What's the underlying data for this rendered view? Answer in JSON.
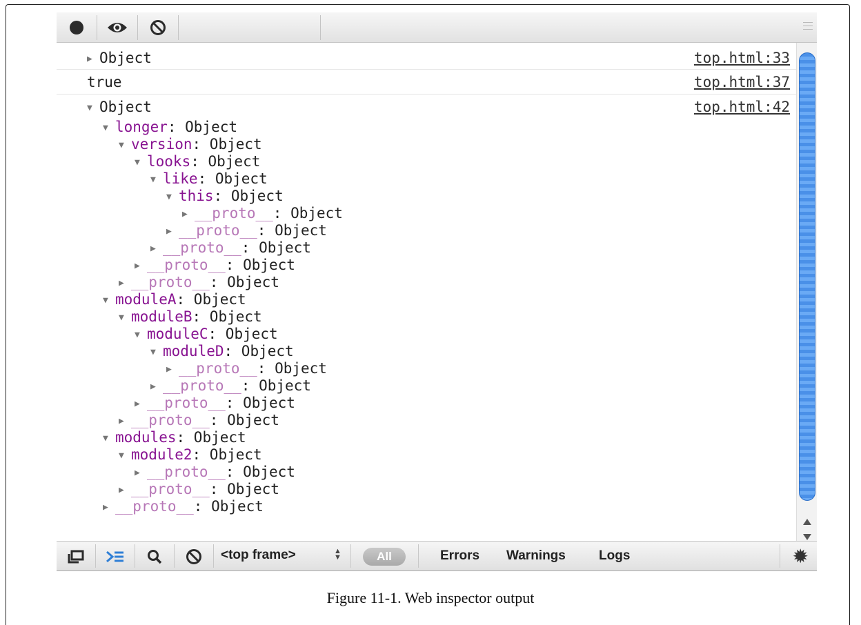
{
  "console_messages": [
    {
      "text": "Object",
      "source": "top.html:33",
      "expanded": false
    },
    {
      "text": "true",
      "source": "top.html:37"
    },
    {
      "text": "Object",
      "source": "top.html:42",
      "expanded": true
    }
  ],
  "tree": [
    {
      "indent": 1,
      "open": true,
      "key": "longer",
      "value": ": Object"
    },
    {
      "indent": 2,
      "open": true,
      "key": "version",
      "value": ": Object"
    },
    {
      "indent": 3,
      "open": true,
      "key": "looks",
      "value": ": Object"
    },
    {
      "indent": 4,
      "open": true,
      "key": "like",
      "value": ": Object"
    },
    {
      "indent": 5,
      "open": true,
      "key": "this",
      "value": ": Object"
    },
    {
      "indent": 6,
      "open": false,
      "key": "__proto__",
      "value": ": Object",
      "proto": true
    },
    {
      "indent": 5,
      "open": false,
      "key": "__proto__",
      "value": ": Object",
      "proto": true
    },
    {
      "indent": 4,
      "open": false,
      "key": "__proto__",
      "value": ": Object",
      "proto": true
    },
    {
      "indent": 3,
      "open": false,
      "key": "__proto__",
      "value": ": Object",
      "proto": true
    },
    {
      "indent": 2,
      "open": false,
      "key": "__proto__",
      "value": ": Object",
      "proto": true
    },
    {
      "indent": 1,
      "open": true,
      "key": "moduleA",
      "value": ": Object"
    },
    {
      "indent": 2,
      "open": true,
      "key": "moduleB",
      "value": ": Object"
    },
    {
      "indent": 3,
      "open": true,
      "key": "moduleC",
      "value": ": Object"
    },
    {
      "indent": 4,
      "open": true,
      "key": "moduleD",
      "value": ": Object"
    },
    {
      "indent": 5,
      "open": false,
      "key": "__proto__",
      "value": ": Object",
      "proto": true
    },
    {
      "indent": 4,
      "open": false,
      "key": "__proto__",
      "value": ": Object",
      "proto": true
    },
    {
      "indent": 3,
      "open": false,
      "key": "__proto__",
      "value": ": Object",
      "proto": true
    },
    {
      "indent": 2,
      "open": false,
      "key": "__proto__",
      "value": ": Object",
      "proto": true
    },
    {
      "indent": 1,
      "open": true,
      "key": "modules",
      "value": ": Object"
    },
    {
      "indent": 2,
      "open": true,
      "key": "module2",
      "value": ": Object"
    },
    {
      "indent": 3,
      "open": false,
      "key": "__proto__",
      "value": ": Object",
      "proto": true
    },
    {
      "indent": 2,
      "open": false,
      "key": "__proto__",
      "value": ": Object",
      "proto": true
    },
    {
      "indent": 1,
      "open": false,
      "key": "__proto__",
      "value": ": Object",
      "proto": true
    }
  ],
  "prompt_symbol": ">",
  "bottom_bar": {
    "frame_select": "<top frame>",
    "all_label": "All",
    "filters": [
      "Errors",
      "Warnings",
      "Logs"
    ]
  },
  "icons": {
    "record": "record-icon",
    "eye": "eye-icon",
    "clear": "clear-icon",
    "menu": "menu-icon",
    "dock": "dock-icon",
    "console": "console-icon",
    "search": "search-icon",
    "settings": "gear-icon"
  },
  "colors": {
    "key": "#881391",
    "proto": "#b777b7",
    "accent": "#4a90e8"
  },
  "caption": "Figure 11-1. Web inspector output"
}
